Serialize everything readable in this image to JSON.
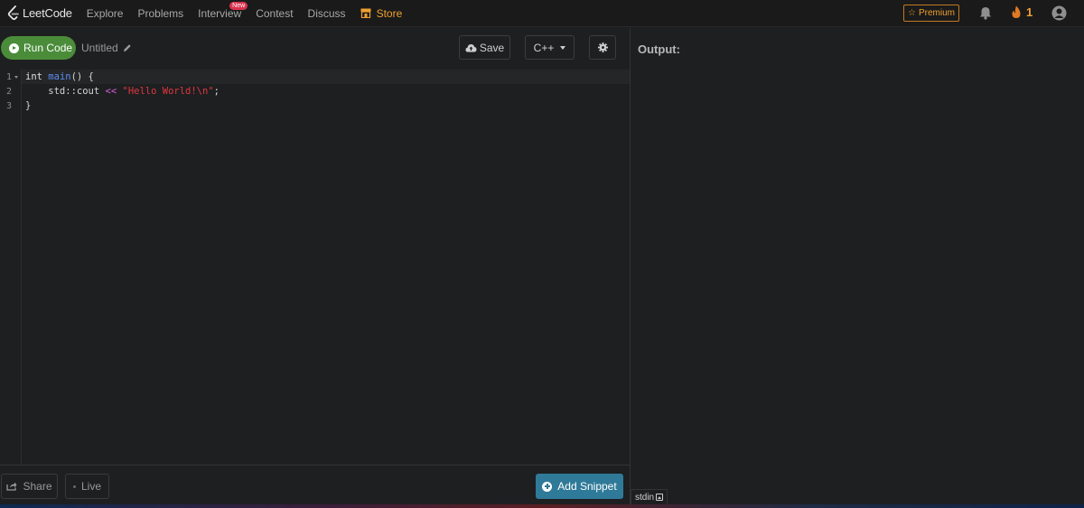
{
  "nav": {
    "logo_text": "LeetCode",
    "items": [
      {
        "label": "Explore"
      },
      {
        "label": "Problems"
      },
      {
        "label": "Interview",
        "badge": "New"
      },
      {
        "label": "Contest"
      },
      {
        "label": "Discuss"
      },
      {
        "label": "Store"
      }
    ],
    "premium_label": "Premium",
    "streak_count": "1"
  },
  "editor": {
    "run_label": "Run Code",
    "file_name": "Untitled",
    "save_label": "Save",
    "language": "C++",
    "line_numbers": [
      "1",
      "2",
      "3"
    ],
    "code_lines": [
      {
        "text": "int main() {"
      },
      {
        "text": "    std::cout << \"Hello World!\\n\";"
      },
      {
        "text": "}"
      }
    ]
  },
  "bottom": {
    "share_label": "Share",
    "live_label": "Live",
    "add_snippet_label": "Add Snippet"
  },
  "output": {
    "title": "Output:",
    "stdin_label": "stdin"
  },
  "colors": {
    "accent_orange": "#f0a030",
    "run_green": "#4a8c3a",
    "snippet_blue": "#2f7a98",
    "badge_red": "#d8324d"
  }
}
